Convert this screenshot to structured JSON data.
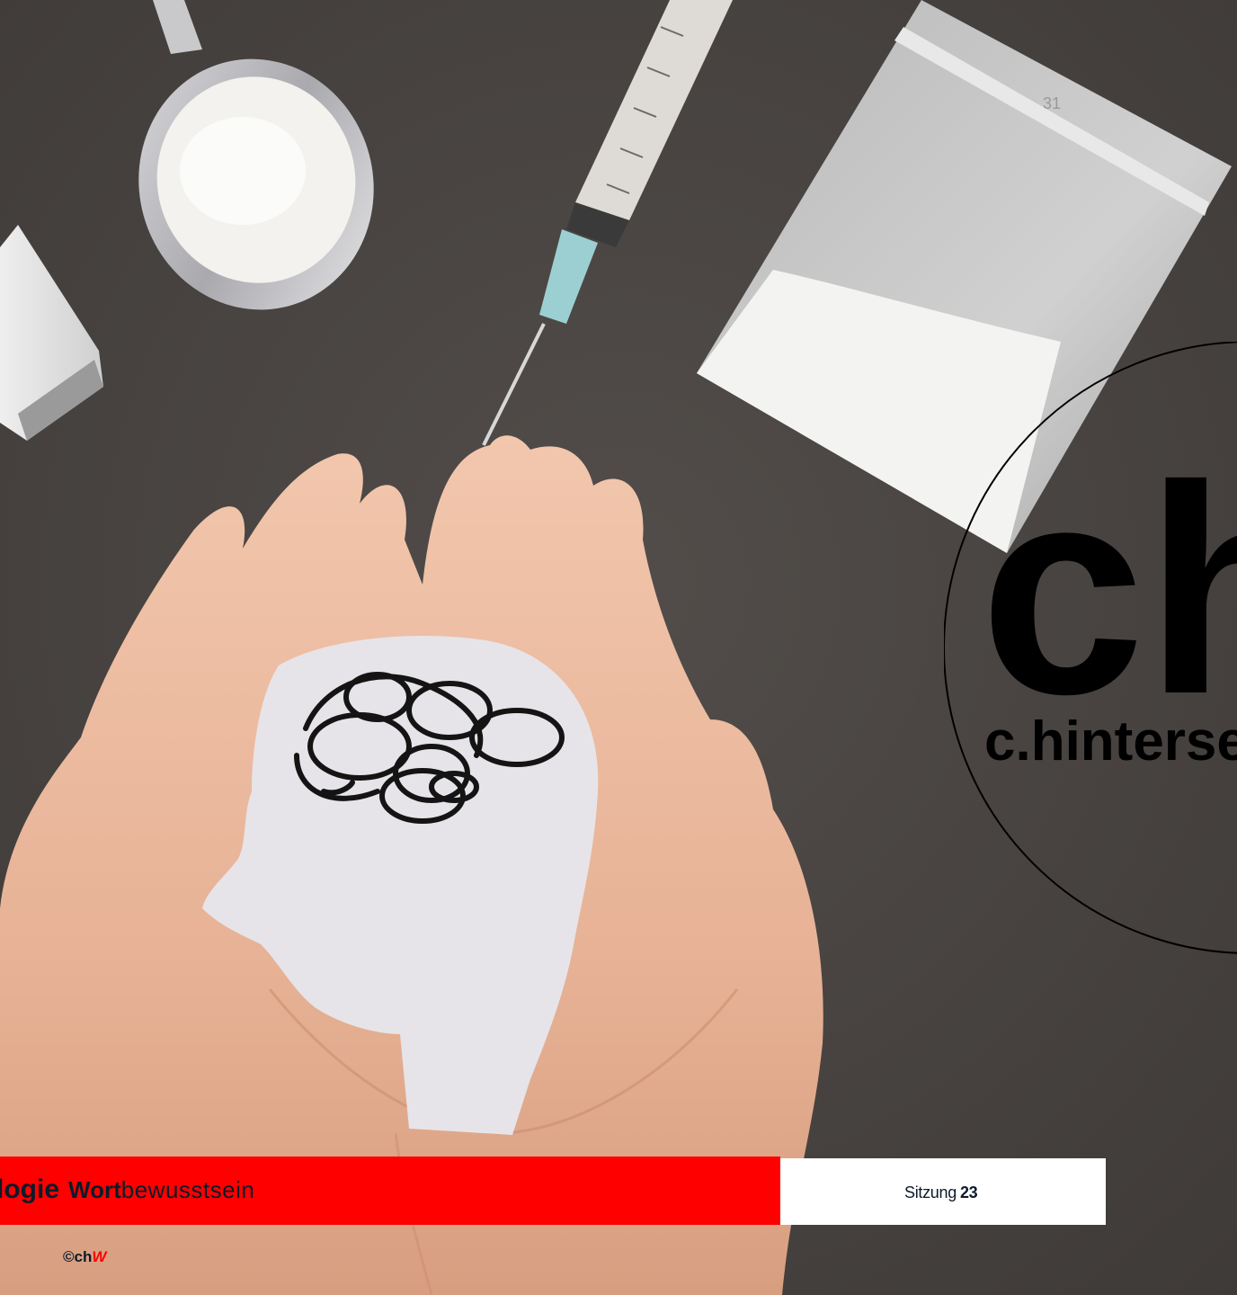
{
  "slide": {
    "page_number": "31",
    "watermark": {
      "monogram": "ch",
      "name": "c.hinterse"
    }
  },
  "footer": {
    "topic": "logie",
    "subtitle_bold": "Wort",
    "subtitle_normal": "bewusstsein",
    "session_label": "Sitzung",
    "session_number": "23",
    "copyright_symbol": "©",
    "copyright_brand": "ch",
    "copyright_accent": "W"
  },
  "colors": {
    "background": "#4a4644",
    "accent_red": "#ff0000",
    "text_dark": "#0d1b2a"
  }
}
